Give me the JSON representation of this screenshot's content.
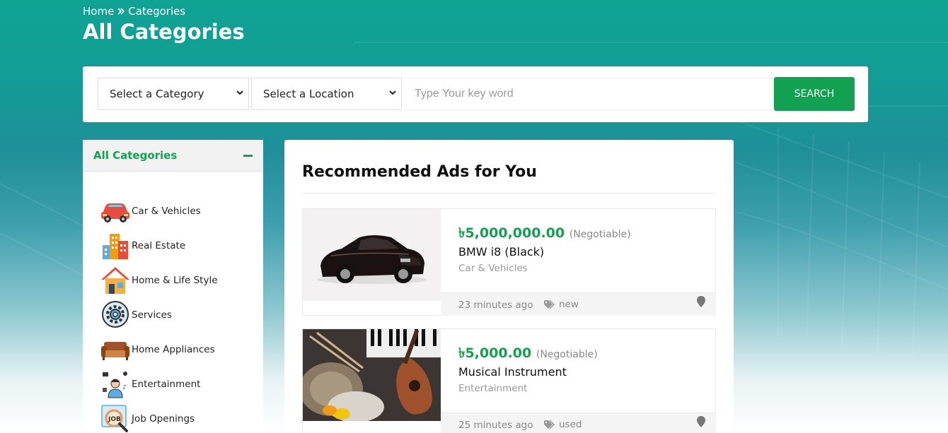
{
  "breadcrumb": {
    "home": "Home",
    "current": "Categories"
  },
  "page_title": "All Categories",
  "search": {
    "category_select": "Select a Category",
    "location_select": "Select a Location",
    "keyword_placeholder": "Type Your key word",
    "button": "SEARCH"
  },
  "sidebar": {
    "heading": "All Categories",
    "items": [
      {
        "label": "Car & Vehicles",
        "icon": "car-icon"
      },
      {
        "label": "Real Estate",
        "icon": "buildings-icon"
      },
      {
        "label": "Home & Life Style",
        "icon": "house-icon"
      },
      {
        "label": "Services",
        "icon": "gear-icon"
      },
      {
        "label": "Home Appliances",
        "icon": "sofa-icon"
      },
      {
        "label": "Entertainment",
        "icon": "entertainment-icon"
      },
      {
        "label": "Job Openings",
        "icon": "job-search-icon"
      }
    ]
  },
  "main": {
    "title": "Recommended Ads for You",
    "ads": [
      {
        "price": "৳5,000,000.00",
        "negotiable": "(Negotiable)",
        "title": "BMW i8 (Black)",
        "category": "Car & Vehicles",
        "time": "23 minutes ago",
        "condition": "new"
      },
      {
        "price": "৳5,000.00",
        "negotiable": "(Negotiable)",
        "title": "Musical Instrument",
        "category": "Entertainment",
        "time": "25 minutes ago",
        "condition": "used"
      }
    ]
  },
  "colors": {
    "accent": "#12a150",
    "header_teal": "#0fa394"
  }
}
